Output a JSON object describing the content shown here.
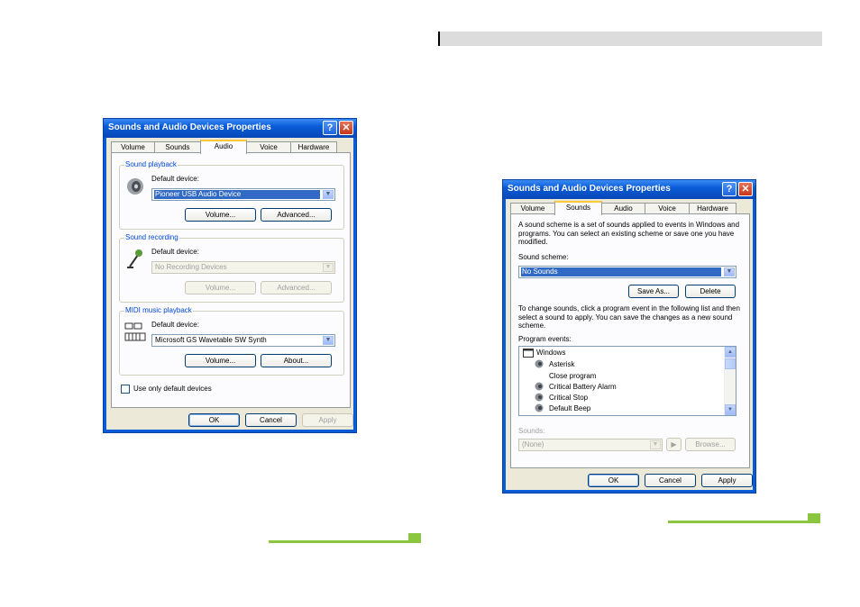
{
  "left_dialog": {
    "title": "Sounds and Audio Devices Properties",
    "help_glyph": "?",
    "close_glyph": "✕",
    "tabs": [
      "Volume",
      "Sounds",
      "Audio",
      "Voice",
      "Hardware"
    ],
    "active_tab": "Audio",
    "playback": {
      "group_label": "Sound playback",
      "device_label": "Default device:",
      "device_value": "Pioneer USB Audio Device",
      "volume_button": "Volume...",
      "advanced_button": "Advanced..."
    },
    "recording": {
      "group_label": "Sound recording",
      "device_label": "Default device:",
      "device_value": "No Recording Devices",
      "volume_button": "Volume...",
      "advanced_button": "Advanced..."
    },
    "midi": {
      "group_label": "MIDI music playback",
      "device_label": "Default device:",
      "device_value": "Microsoft GS Wavetable SW Synth",
      "volume_button": "Volume...",
      "about_button": "About..."
    },
    "use_default_checkbox": "Use only default devices",
    "ok_button": "OK",
    "cancel_button": "Cancel",
    "apply_button": "Apply"
  },
  "right_dialog": {
    "title": "Sounds and Audio Devices Properties",
    "help_glyph": "?",
    "close_glyph": "✕",
    "tabs": [
      "Volume",
      "Sounds",
      "Audio",
      "Voice",
      "Hardware"
    ],
    "active_tab": "Sounds",
    "scheme_description": "A sound scheme is a set of sounds applied to events in Windows and programs. You can select an existing scheme or save one you have modified.",
    "scheme_label": "Sound scheme:",
    "scheme_value": "No Sounds",
    "save_as_button": "Save As...",
    "delete_button": "Delete",
    "events_description": "To change sounds, click a program event in the following list and then select a sound to apply. You can save the changes as a new sound scheme.",
    "events_label": "Program events:",
    "events": [
      "Windows",
      "Asterisk",
      "Close program",
      "Critical Battery Alarm",
      "Critical Stop",
      "Default Beep"
    ],
    "sounds_label": "Sounds:",
    "sounds_value": "(None)",
    "play_glyph": "▶",
    "browse_button": "Browse...",
    "ok_button": "OK",
    "cancel_button": "Cancel",
    "apply_button": "Apply"
  },
  "colors": {
    "accent_green": "#8cc63f",
    "xp_title_blue": "#0a5bd6",
    "group_label_blue": "#0046d5",
    "selection_blue": "#316ac5"
  }
}
